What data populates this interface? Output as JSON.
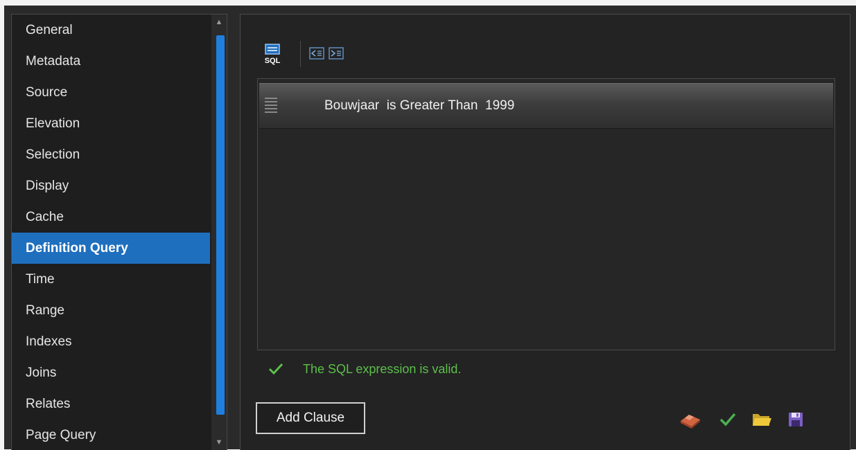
{
  "nav": {
    "items": [
      {
        "label": "General"
      },
      {
        "label": "Metadata"
      },
      {
        "label": "Source"
      },
      {
        "label": "Elevation"
      },
      {
        "label": "Selection"
      },
      {
        "label": "Display"
      },
      {
        "label": "Cache"
      },
      {
        "label": "Definition Query",
        "active": true
      },
      {
        "label": "Time"
      },
      {
        "label": "Range"
      },
      {
        "label": "Indexes"
      },
      {
        "label": "Joins"
      },
      {
        "label": "Relates"
      },
      {
        "label": "Page Query"
      }
    ]
  },
  "toolbar": {
    "sql_icon_label": "SQL",
    "icons": [
      "sql-mode-icon",
      "outdent-icon",
      "indent-icon"
    ]
  },
  "clause": {
    "field": "Bouwjaar",
    "operator": "is Greater Than",
    "value": "1999"
  },
  "status": {
    "text": "The SQL expression is valid.",
    "color": "#5cbf4a"
  },
  "buttons": {
    "add_clause": "Add Clause"
  },
  "actions": [
    "clear-eraser-icon",
    "verify-check-icon",
    "load-folder-icon",
    "save-disk-icon"
  ],
  "colors": {
    "accent": "#1f6fbf",
    "background": "#232323",
    "valid": "#5cbf4a"
  }
}
